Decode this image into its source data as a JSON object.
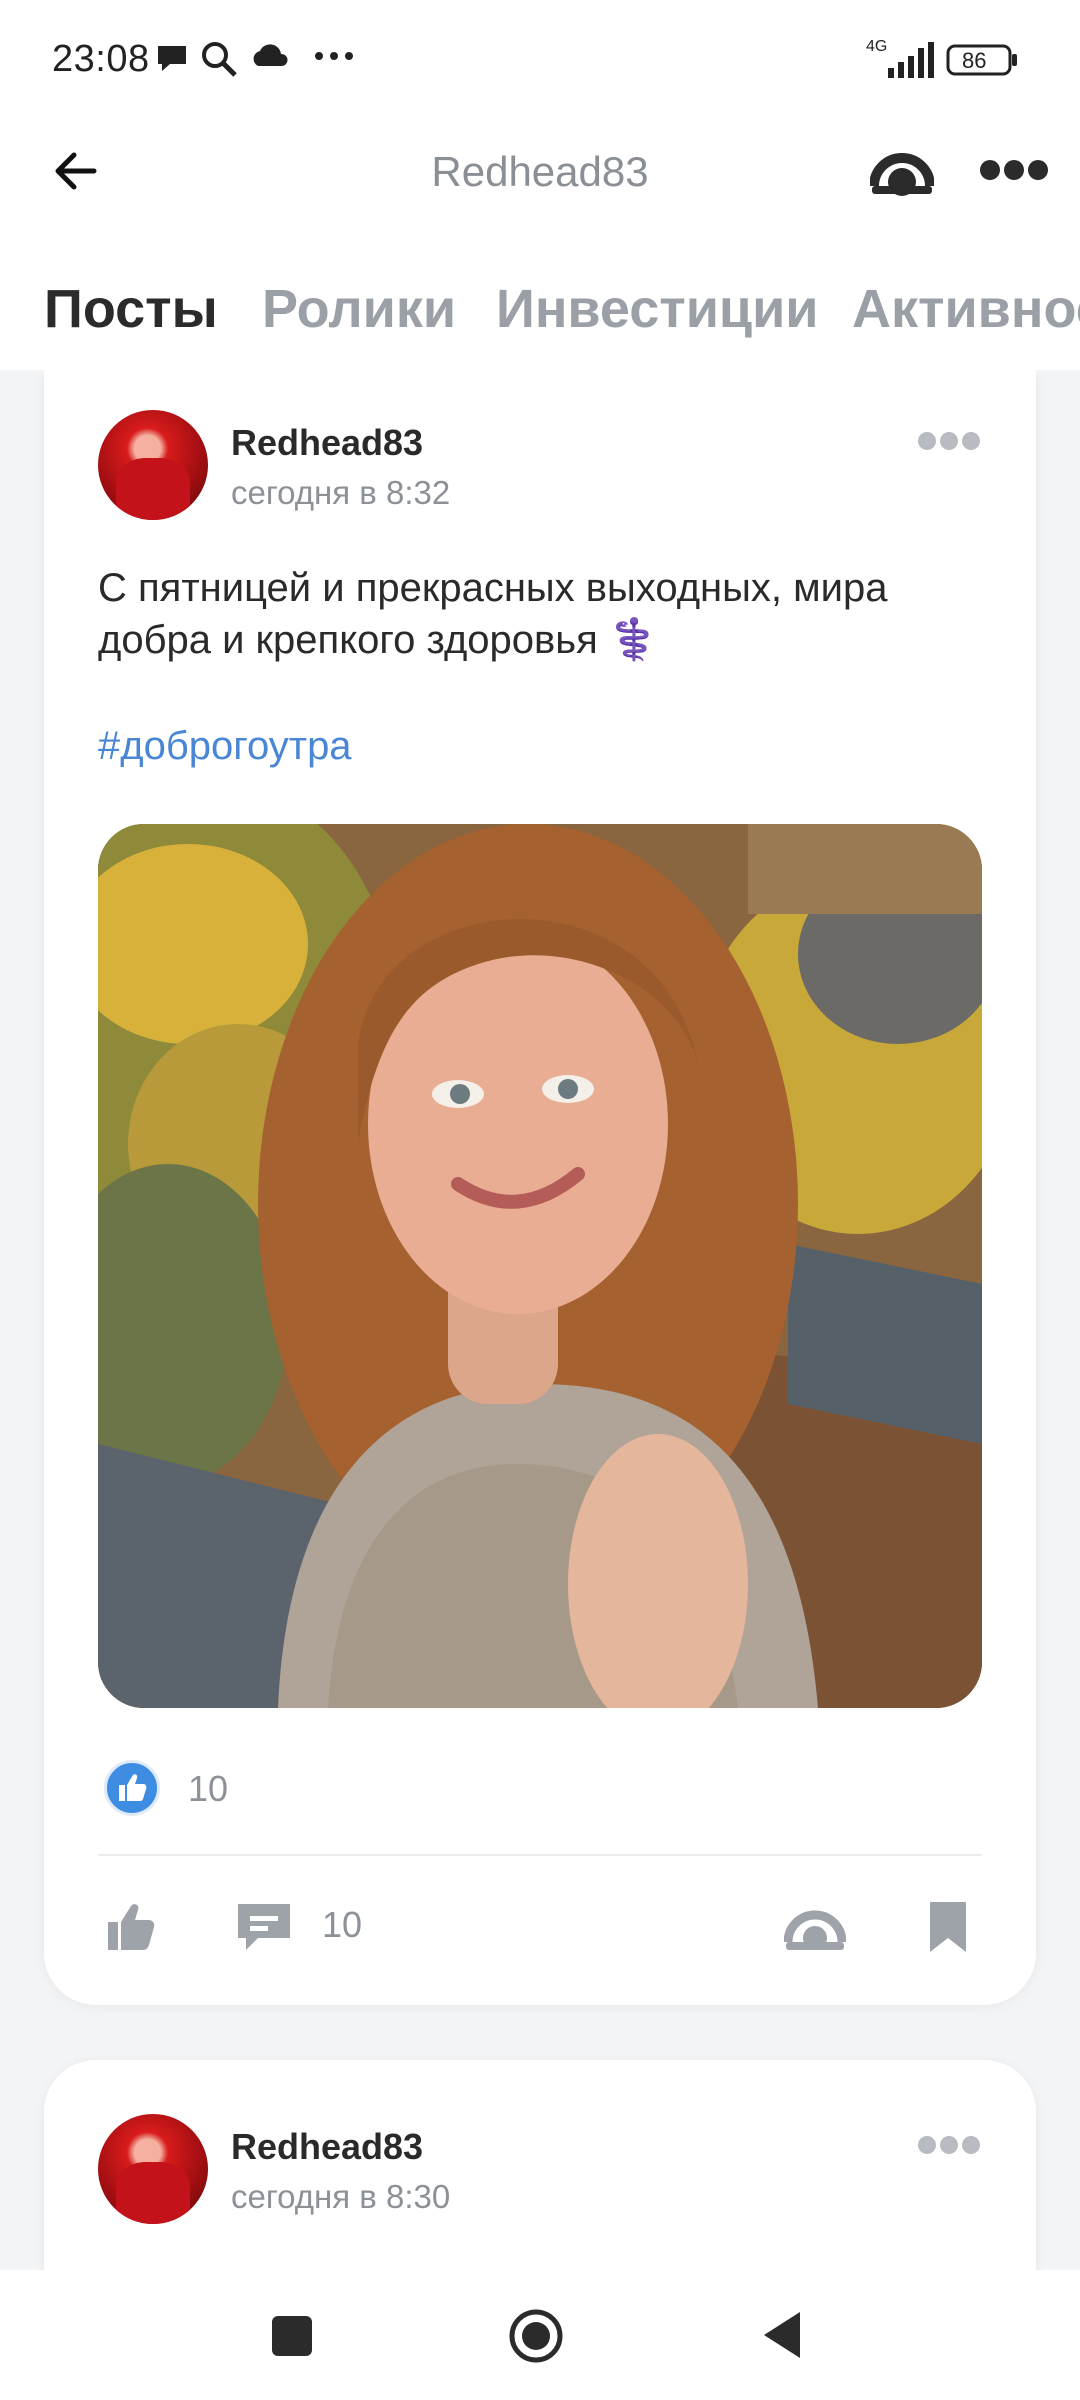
{
  "status_bar": {
    "time": "23:08",
    "network": "4G",
    "battery": "86",
    "icons": [
      "chat-bubble-icon",
      "search-icon",
      "cloud-icon",
      "more-dots-icon",
      "signal-icon",
      "battery-icon"
    ]
  },
  "header": {
    "title": "Redhead83",
    "back_icon": "arrow-left-icon",
    "share_icon": "share-icon",
    "menu_icon": "more-dots-icon"
  },
  "tabs": [
    {
      "label": "Посты",
      "active": true
    },
    {
      "label": "Ролики",
      "active": false
    },
    {
      "label": "Инвестиции",
      "active": false
    },
    {
      "label": "Активнос",
      "active": false
    }
  ],
  "posts": [
    {
      "author": "Redhead83",
      "time": "сегодня в 8:32",
      "text": "С пятницей и прекрасных выходных, мира добра и крепкого здоровья ⚕️",
      "hashtag": "#доброгоутра",
      "likes": "10",
      "comments": "10"
    },
    {
      "author": "Redhead83",
      "time": "сегодня в 8:30"
    }
  ],
  "colors": {
    "accent": "#3f8de3",
    "hashtag": "#4a86d6",
    "muted": "#8c9198",
    "feed_bg": "#f3f4f6"
  },
  "navbar": {
    "icons": [
      "recent-apps-icon",
      "home-icon",
      "back-icon"
    ]
  }
}
